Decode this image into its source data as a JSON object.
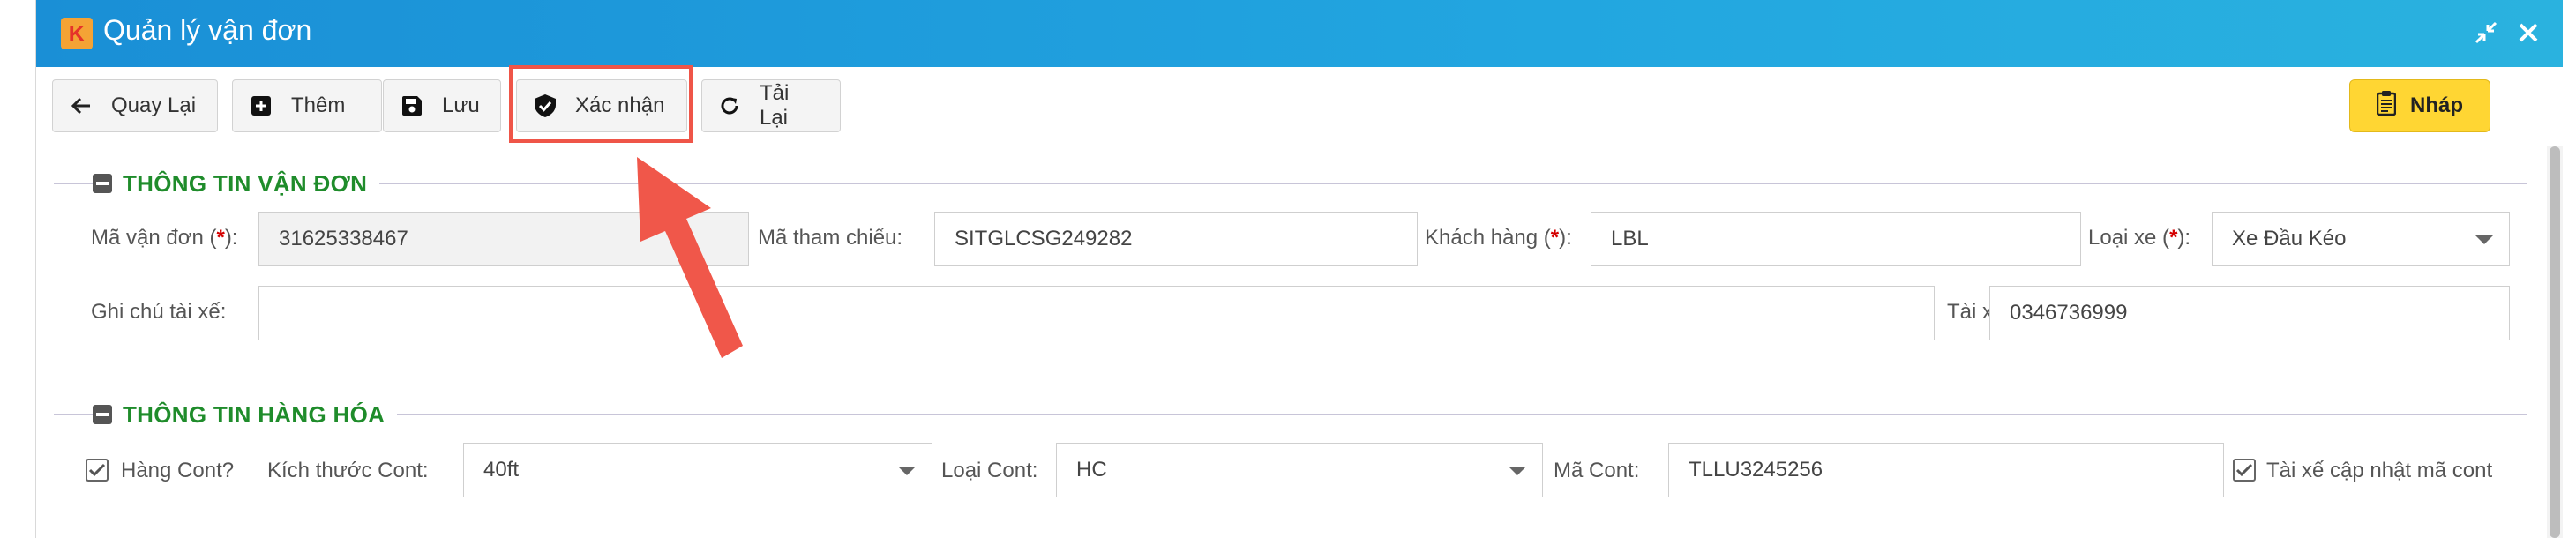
{
  "window": {
    "title": "Quản lý vận đơn",
    "logo_letter": "K",
    "controls": {
      "collapse_icon": "collapse-arrows-icon",
      "close_icon": "close-icon"
    }
  },
  "toolbar": {
    "back_label": "Quay Lại",
    "add_label": "Thêm",
    "save_label": "Lưu",
    "confirm_label": "Xác nhận",
    "reload_label": "Tải Lại",
    "status_label": "Nháp"
  },
  "shipment_section": {
    "title": "THÔNG TIN VẬN ĐƠN",
    "waybill_label": "Mã vận đơn (",
    "waybill_label_req": "*",
    "waybill_label_end": "):",
    "waybill_value": "31625338467",
    "reference_label": "Mã tham chiếu:",
    "reference_value": "SITGLCSG249282",
    "customer_label": "Khách hàng (",
    "customer_label_req": "*",
    "customer_label_end": "):",
    "customer_value": "LBL",
    "vehicle_type_label": "Loại xe (",
    "vehicle_type_label_req": "*",
    "vehicle_type_label_end": "):",
    "vehicle_type_value": "Xe Đầu Kéo",
    "driver_note_label": "Ghi chú tài xế:",
    "driver_note_value": "",
    "driver_label": "Tài xế:",
    "driver_value": "0346736999"
  },
  "cargo_section": {
    "title": "THÔNG TIN HÀNG HÓA",
    "container_check_label": "Hàng Cont?",
    "container_size_label": "Kích thước Cont:",
    "container_size_value": "40ft",
    "container_type_label": "Loại Cont:",
    "container_type_value": "HC",
    "container_code_label": "Mã Cont:",
    "container_code_value": "TLLU3245256",
    "driver_update_label": "Tài xế cập nhật mã cont"
  },
  "colors": {
    "titlebar": "#1a8fd6",
    "section_title": "#1f8c2b",
    "status_button": "#ffd633",
    "highlight": "#ef5548"
  }
}
